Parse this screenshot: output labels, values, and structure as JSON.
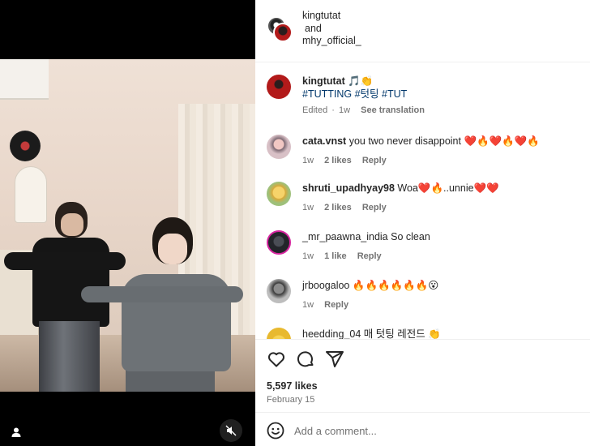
{
  "post": {
    "author": "kingtutat",
    "and_text": "and",
    "collaborator": "mhy_official_",
    "caption_emojis": "🎵👏",
    "caption_tags": "#TUTTING #텃팅 #TUT",
    "caption_edited": "Edited",
    "caption_time": "1w",
    "see_translation": "See translation"
  },
  "comments": [
    {
      "user": "cata.vnst",
      "text": "you two never disappoint ❤️🔥❤️🔥❤️🔥",
      "time": "1w",
      "likes": "2 likes",
      "reply": "Reply"
    },
    {
      "user": "shruti_upadhyay98",
      "text": "Woa❤️🔥..unnie❤️❤️",
      "time": "1w",
      "likes": "2 likes",
      "reply": "Reply"
    },
    {
      "user": "_mr_paawna_india",
      "text": "So clean",
      "time": "1w",
      "likes": "1 like",
      "reply": "Reply"
    },
    {
      "user": "jrboogaloo",
      "text": "🔥🔥🔥🔥🔥🔥😮",
      "time": "1w",
      "likes": "",
      "reply": "Reply"
    },
    {
      "user": "heedding_04",
      "text": "매 텃팅 레전드 👏",
      "time": "",
      "likes": "",
      "reply": ""
    }
  ],
  "footer": {
    "likes": "5,597 likes",
    "date": "February 15",
    "comment_placeholder": "Add a comment..."
  },
  "icons": [
    "user-tag-icon",
    "mute-icon",
    "heart-icon",
    "comment-icon",
    "share-icon",
    "emoji-icon"
  ]
}
